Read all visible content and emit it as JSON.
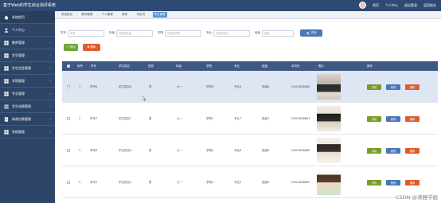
{
  "header": {
    "title": "基于Web的学生综合测评系统",
    "links": [
      "首页",
      "个人中心",
      "退出登录",
      "返回前台"
    ]
  },
  "sidebar": {
    "items": [
      {
        "label": "系统首页",
        "icon": "home-icon",
        "active": true
      },
      {
        "label": "个人中心",
        "icon": "user-icon"
      },
      {
        "label": "教师管理",
        "icon": "grid-icon"
      },
      {
        "label": "学生管理",
        "icon": "grid-icon"
      },
      {
        "label": "学生信息管理",
        "icon": "grid-icon"
      },
      {
        "label": "学院管理",
        "icon": "grid-icon"
      },
      {
        "label": "专业管理",
        "icon": "grid-icon"
      },
      {
        "label": "学生成绩管理",
        "icon": "list-icon"
      },
      {
        "label": "体测分数管理",
        "icon": "document-icon"
      },
      {
        "label": "系统管理",
        "icon": "grid-icon"
      }
    ]
  },
  "breadcrumb": [
    "系统首页",
    "教师管理",
    "个人管理",
    "教师",
    "学生列",
    "学生管理"
  ],
  "search": {
    "fields": [
      {
        "label": "学号",
        "placeholder": "学号"
      },
      {
        "label": "年级",
        "placeholder": "请选择年级"
      },
      {
        "label": "学院",
        "placeholder": "请选择学院"
      },
      {
        "label": "专业",
        "placeholder": "请选择专业"
      },
      {
        "label": "班级",
        "placeholder": "班级"
      }
    ],
    "button": "查询"
  },
  "actions": {
    "add": "+ 添加",
    "delete": "✖ 删除"
  },
  "table": {
    "headers": [
      "序号",
      "学号",
      "学生姓名",
      "性别",
      "年级",
      "学院",
      "专业",
      "班级",
      "手机号",
      "照片",
      "操作"
    ],
    "rows": [
      {
        "index": "1",
        "id": "学号8",
        "name": "学生姓名8",
        "gender": "男",
        "grade": "大一",
        "college": "学院8",
        "major": "专业8",
        "class": "班级8",
        "phone": "13823888888"
      },
      {
        "index": "2",
        "id": "学号7",
        "name": "学生姓名7",
        "gender": "男",
        "grade": "大一",
        "college": "学院7",
        "major": "专业7",
        "class": "班级7",
        "phone": "13823888887"
      },
      {
        "index": "3",
        "id": "学号6",
        "name": "学生姓名6",
        "gender": "男",
        "grade": "大一",
        "college": "学院6",
        "major": "专业6",
        "class": "班级6",
        "phone": "13823888886"
      },
      {
        "index": "4",
        "id": "学号5",
        "name": "学生姓名5",
        "gender": "男",
        "grade": "大一",
        "college": "学院5",
        "major": "专业5",
        "class": "班级5",
        "phone": "13823888885"
      }
    ],
    "row_actions": {
      "view": "详情",
      "edit": "修改",
      "delete": "删除"
    }
  },
  "watermark": "CSDN @清雅学姐"
}
